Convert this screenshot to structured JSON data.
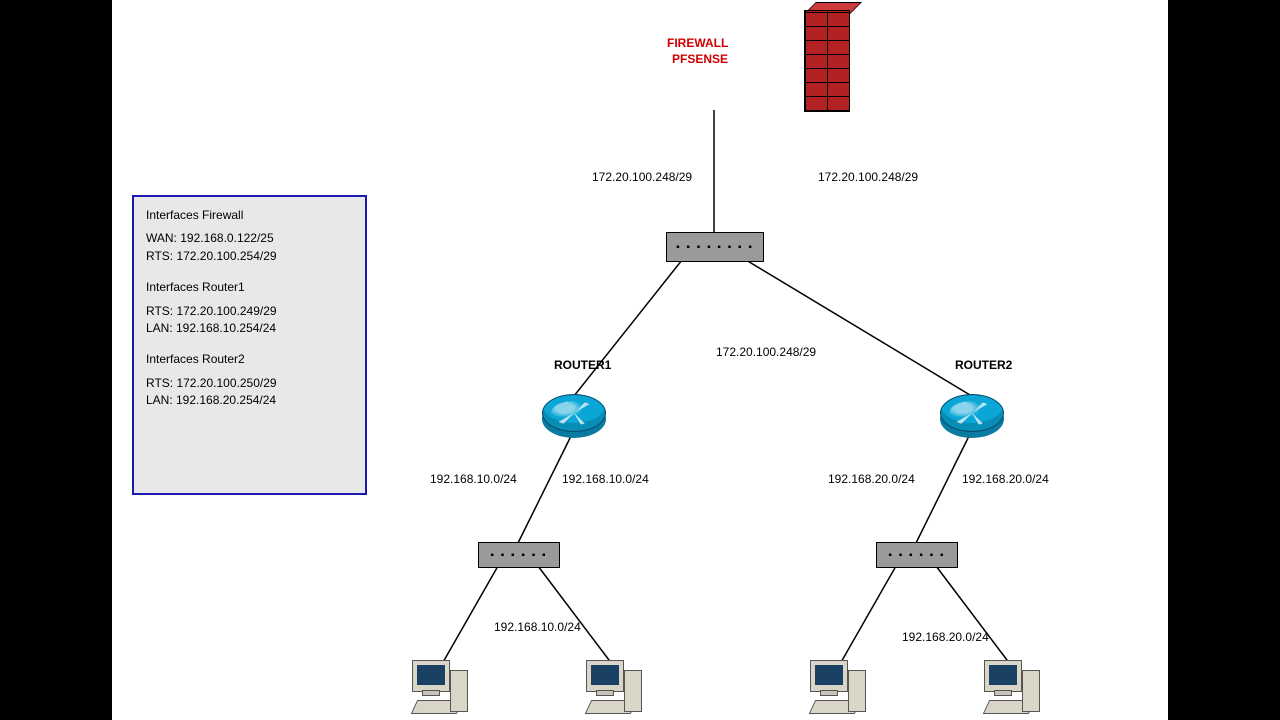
{
  "firewall_label_l1": "FIREWALL",
  "firewall_label_l2": "PFSENSE",
  "link_fw_switch_left": "172.20.100.248/29",
  "link_fw_switch_right": "172.20.100.248/29",
  "link_switch_routers": "172.20.100.248/29",
  "router1_label": "ROUTER1",
  "router2_label": "ROUTER2",
  "r1_net_left": "192.168.10.0/24",
  "r1_net_right": "192.168.10.0/24",
  "r1_pc": "192.168.10.0/24",
  "r2_net_left": "192.168.20.0/24",
  "r2_net_right": "192.168.20.0/24",
  "r2_pc": "192.168.20.0/24",
  "info": {
    "h1": "Interfaces Firewall",
    "fw_wan": "WAN: 192.168.0.122/25",
    "fw_rts": "RTS: 172.20.100.254/29",
    "h2": "Interfaces Router1",
    "r1_rts": "RTS: 172.20.100.249/29",
    "r1_lan": "LAN: 192.168.10.254/24",
    "h3": "Interfaces Router2",
    "r2_rts": "RTS: 172.20.100.250/29",
    "r2_lan": "LAN: 192.168.20.254/24"
  },
  "switch_dots": "▪ ▪ ▪ ▪ ▪ ▪ ▪ ▪",
  "switch_dots_sm": "▪ ▪ ▪ ▪ ▪ ▪"
}
